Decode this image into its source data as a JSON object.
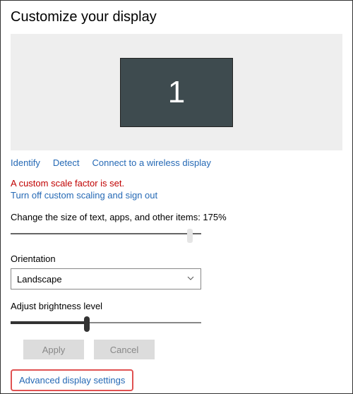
{
  "title": "Customize your display",
  "monitor": {
    "number": "1"
  },
  "links": {
    "identify": "Identify",
    "detect": "Detect",
    "wireless": "Connect to a wireless display"
  },
  "warning": "A custom scale factor is set.",
  "turn_off_link": "Turn off custom scaling and sign out",
  "scale": {
    "label_prefix": "Change the size of text, apps, and other items: ",
    "label_full": "Change the size of text, apps, and other items: 175%",
    "value": "175%"
  },
  "orientation": {
    "label": "Orientation",
    "selected": "Landscape"
  },
  "brightness": {
    "label": "Adjust brightness level"
  },
  "buttons": {
    "apply": "Apply",
    "cancel": "Cancel"
  },
  "advanced": "Advanced display settings"
}
